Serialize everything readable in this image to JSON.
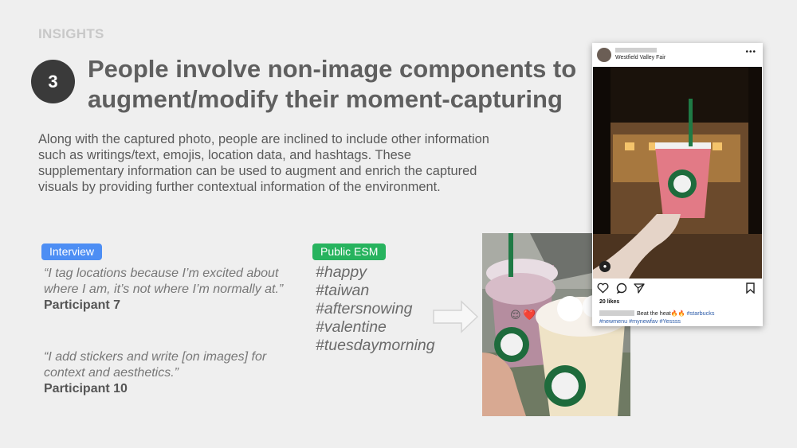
{
  "slide": {
    "section_label": "INSIGHTS",
    "number": "3",
    "headline_lines": [
      "People involve non-image components to",
      "augment/modify their moment-capturing"
    ],
    "body_lines": [
      "Along with the captured photo, people are inclined to include other information",
      "such as writings/text, emojis, location data, and hashtags. These",
      "supplementary information can be used to augment and enrich the captured",
      "visuals by providing further contextual information of the environment."
    ]
  },
  "interview": {
    "tag": "Interview",
    "tag_color": "#4d8ef4",
    "quotes": [
      {
        "lines": [
          "“I tag locations because I’m excited about",
          "where I am, it’s not where I’m normally at.”"
        ],
        "participant": "Participant 7"
      },
      {
        "lines": [
          "“I add stickers and write [on images] for",
          "context and aesthetics.”"
        ],
        "participant": "Participant 10"
      }
    ]
  },
  "esm": {
    "tag": "Public ESM",
    "tag_color": "#27b35e",
    "hashtags": [
      "#happy",
      "#taiwan",
      "#aftersnowing",
      "#valentine",
      "#tuesdaymorning"
    ]
  },
  "instagram": {
    "location": "Westfield Valley Fair",
    "likes": "20 likes",
    "caption_text": "Beat the heat🔥🔥",
    "caption_tag": "#starbucks",
    "caption_line2": "#newmenu #mynewfav #Yessss",
    "icons": [
      "heart-icon",
      "comment-icon",
      "share-icon",
      "bookmark-icon",
      "tagged-user-icon",
      "more-icon"
    ]
  },
  "stickers": {
    "emoji_face": "😌",
    "emoji_heart": "❤️"
  }
}
